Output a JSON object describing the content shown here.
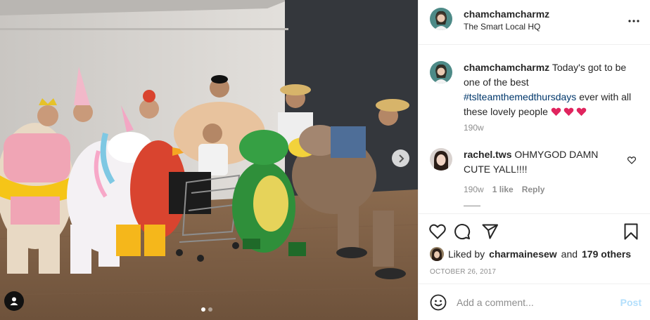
{
  "post": {
    "username": "chamchamcharmz",
    "location": "The Smart Local HQ"
  },
  "caption": {
    "username": "chamchamcharmz",
    "text_before": "Today's got to be one of the best",
    "hashtag": "#tslteamthemedthursdays",
    "text_after": "ever with all these lovely people",
    "hearts": 3,
    "time": "190w"
  },
  "comment": {
    "username": "rachel.tws",
    "text": "OHMYGOD DAMN CUTE YALL!!!!",
    "time": "190w",
    "likes": "1 like",
    "reply_label": "Reply"
  },
  "likes": {
    "prefix": "Liked by",
    "user": "charmainesew",
    "conjunction": "and",
    "others": "179 others"
  },
  "date": "OCTOBER 26, 2017",
  "composer": {
    "placeholder": "Add a comment...",
    "post_label": "Post"
  },
  "carousel": {
    "slides": 2,
    "active": 0
  },
  "icons": {
    "options": "more-horizontal-icon",
    "like": "heart-outline-icon",
    "comment": "speech-bubble-icon",
    "share": "paper-plane-icon",
    "save": "bookmark-icon",
    "next": "chevron-right-icon",
    "tagged": "user-tag-icon",
    "emoji": "smiley-icon"
  },
  "colors": {
    "hashtag": "#00376b",
    "heart_emoji": "#e0245e",
    "muted": "#8e8e8e",
    "post_disabled": "#b2dffc"
  }
}
